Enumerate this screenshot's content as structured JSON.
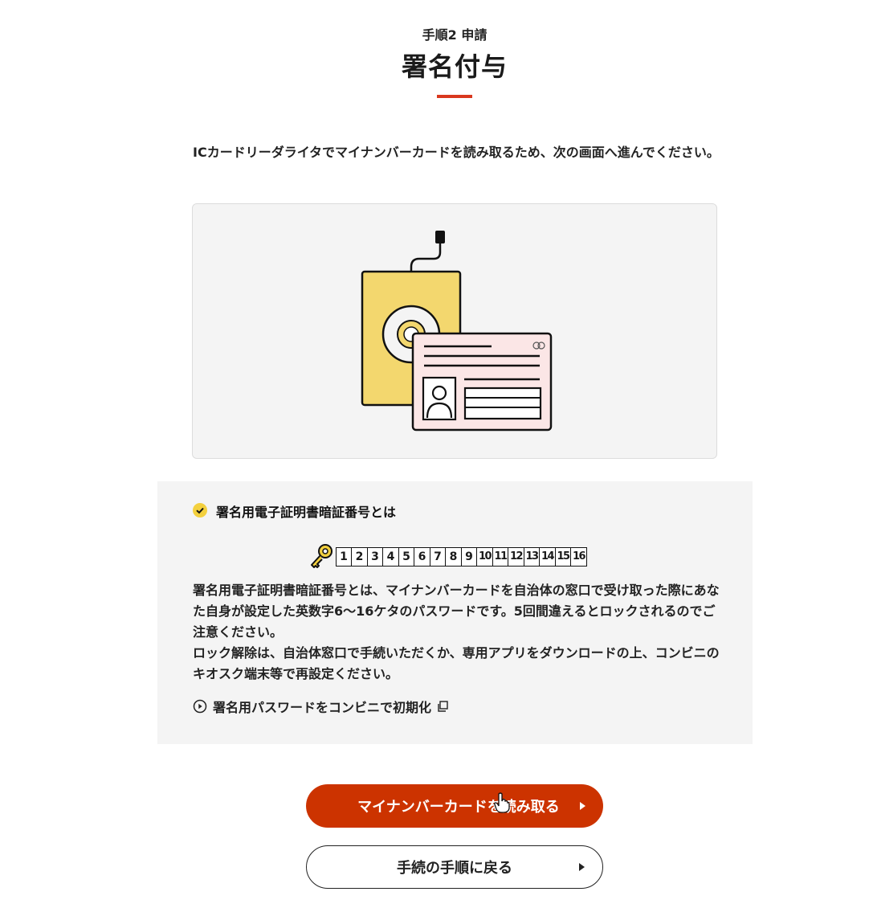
{
  "header": {
    "step_label": "手順2 申請",
    "title": "署名付与"
  },
  "instruction": "ICカードリーダライタでマイナンバーカードを読み取るため、次の画面へ進んでください。",
  "illustration": {
    "icon": "card-reader-with-mynumber-card-illustration",
    "colors": {
      "reader": "#f3d76e",
      "card": "#fbe6e6",
      "background": "#f4f4f4"
    }
  },
  "info": {
    "heading": "署名用電子証明書暗証番号とは",
    "pin_digits": [
      "1",
      "2",
      "3",
      "4",
      "5",
      "6",
      "7",
      "8",
      "9",
      "10",
      "11",
      "12",
      "13",
      "14",
      "15",
      "16"
    ],
    "body_lines": [
      "署名用電子証明書暗証番号とは、マイナンバーカードを自治体の窓口で受け取った際にあなた自身が設定した英数字6〜16ケタのパスワードです。5回間違えるとロックされるのでご注意ください。",
      "ロック解除は、自治体窓口で手続いただくか、専用アプリをダウンロードの上、コンビニのキオスク端末等で再設定ください。"
    ],
    "link_label": "署名用パスワードをコンビニで初期化"
  },
  "buttons": {
    "primary_label": "マイナンバーカードを読み取る",
    "secondary_label": "手続の手順に戻る"
  },
  "colors": {
    "accent": "#cc3300",
    "underline": "#d9381e",
    "check": "#f3d03e"
  }
}
